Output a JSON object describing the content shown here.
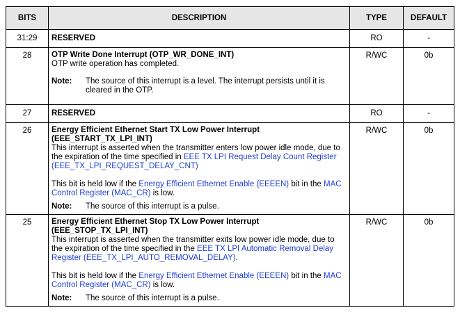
{
  "headers": {
    "bits": "BITS",
    "description": "DESCRIPTION",
    "type": "TYPE",
    "default": "DEFAULT"
  },
  "rows": [
    {
      "bits": "31:29",
      "title": "RESERVED",
      "type": "RO",
      "default": "-"
    },
    {
      "bits": "28",
      "title": "OTP Write Done Interrupt (OTP_WR_DONE_INT)",
      "desc": "OTP write operation has completed.",
      "note_label": "Note:",
      "note_text": "The source of this interrupt is a level. The interrupt persists until it is cleared in the OTP.",
      "type": "R/WC",
      "default": "0b"
    },
    {
      "bits": "27",
      "title": "RESERVED",
      "type": "RO",
      "default": "-"
    },
    {
      "bits": "26",
      "title": "Energy Efficient Ethernet Start TX Low Power Interrupt (EEE_START_TX_LPI_INT)",
      "desc_pre": "This interrupt is asserted when the transmitter enters low power idle mode, due to the expiration of the time specified in ",
      "desc_link": "EEE TX LPI Request Delay Count Register (EEE_TX_LPI_REQUEST_DELAY_CNT)",
      "p2_pre": "This bit is held low if the ",
      "p2_link1": "Energy Efficient Ethernet Enable (EEEEN)",
      "p2_mid": " bit in the ",
      "p2_link2": "MAC Control Register (MAC_CR)",
      "p2_post": " is low.",
      "note_label": "Note:",
      "note_text": "The source of this interrupt is a pulse.",
      "type": "R/WC",
      "default": "0b"
    },
    {
      "bits": "25",
      "title": "Energy Efficient Ethernet Stop TX Low Power Interrupt (EEE_STOP_TX_LPI_INT)",
      "desc_pre": "This interrupt is asserted when the transmitter exits low power idle mode, due to the expiration of the time specified in the ",
      "desc_link": "EEE TX LPI Automatic Removal Delay Register (EEE_TX_LPI_AUTO_REMOVAL_DELAY)",
      "desc_post": ".",
      "p2_pre": "This bit is held low if the ",
      "p2_link1": "Energy Efficient Ethernet Enable (EEEEN)",
      "p2_mid": " bit in the ",
      "p2_link2": "MAC Control Register (MAC_CR)",
      "p2_post": " is low.",
      "note_label": "Note:",
      "note_text": "The source of this interrupt is a pulse.",
      "type": "R/WC",
      "default": "0b"
    }
  ]
}
